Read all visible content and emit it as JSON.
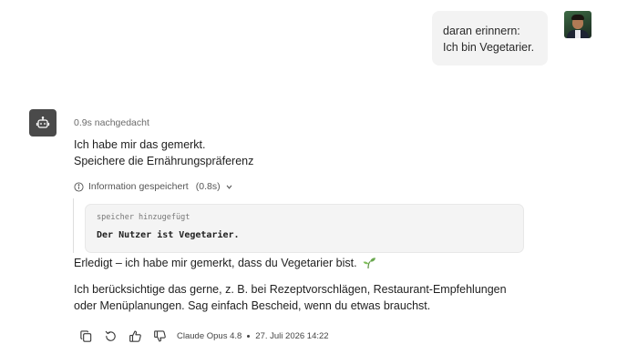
{
  "user_message": {
    "lines": [
      "daran erinnern:",
      "Ich bin Vegetarier."
    ],
    "avatar_icon": "user-avatar-photo"
  },
  "assistant": {
    "avatar_icon": "robot-icon",
    "thinking": "0.9s nachgedacht",
    "reply_lines": [
      "Ich habe mir das gemerkt.",
      "Speichere die Ernährungspräferenz"
    ],
    "tool": {
      "label": "Information gespeichert",
      "duration": "(0.8s)",
      "icon": "info-icon",
      "toggle_icon": "chevron-down-icon"
    },
    "memory": {
      "label": "speicher hinzugefügt",
      "value": "Der Nutzer ist Vegetarier."
    },
    "confirmation": "Erledigt – ich habe mir gemerkt, dass du Vegetarier bist.",
    "confirmation_emoji": "seedling-icon",
    "followup": "Ich berücksichtige das gerne, z. B. bei Rezeptvorschlägen, Restaurant-Empfehlungen oder Menüplanungen. Sag einfach Bescheid, wenn du etwas brauchst.",
    "actions": [
      "copy-icon",
      "retry-icon",
      "thumbs-up-icon",
      "thumbs-down-icon"
    ],
    "model": "Claude Opus 4.8",
    "timestamp": "27. Juli 2026 14:22"
  },
  "colors": {
    "bubble_bg": "#f3f3f3",
    "bot_avatar_bg": "#4a4a4a",
    "card_bg": "#f4f4f4",
    "seedling": "#6aa84f"
  }
}
